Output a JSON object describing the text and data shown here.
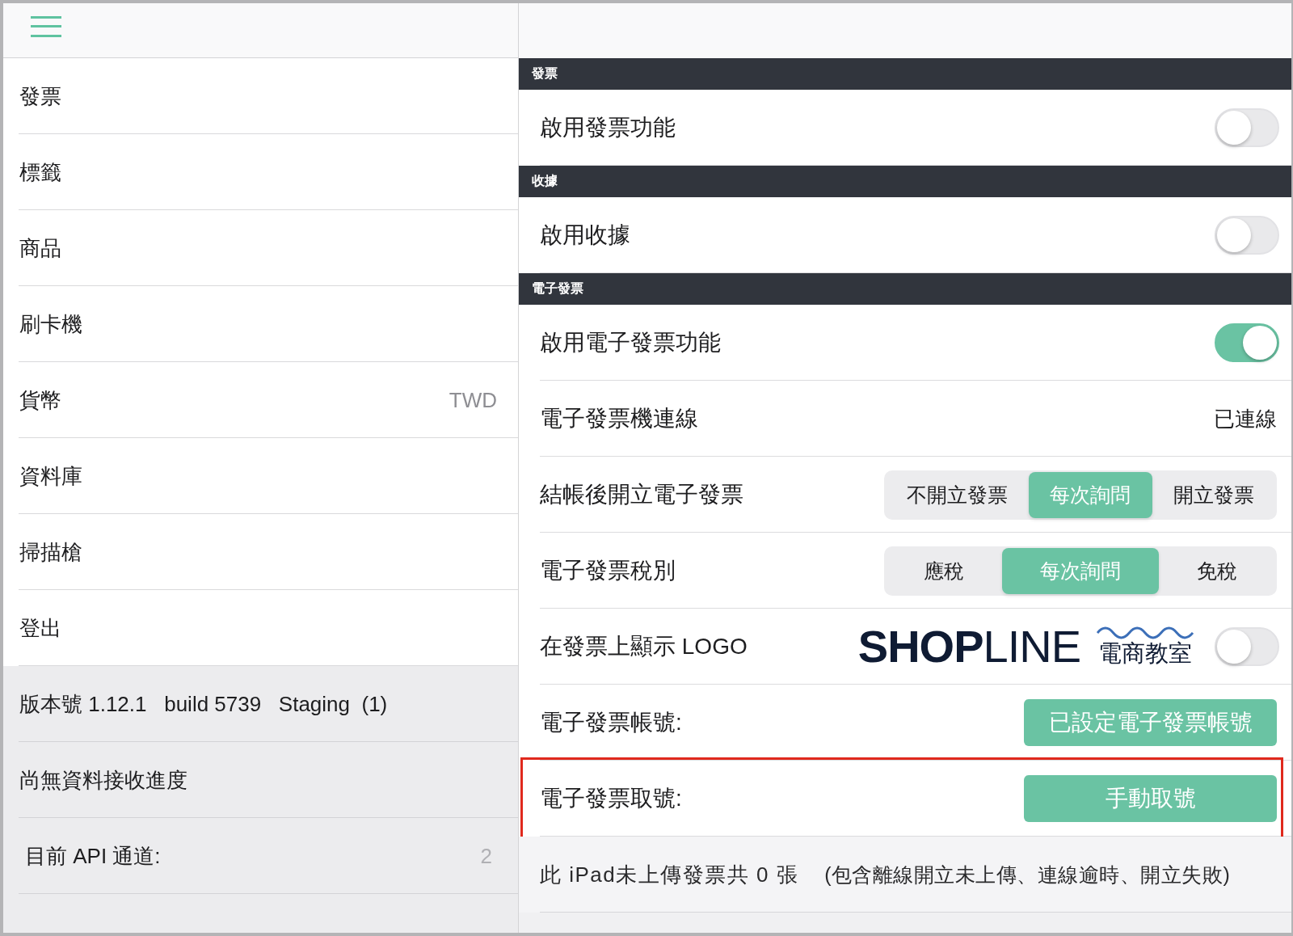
{
  "sidebar": {
    "items": [
      {
        "label": "發票",
        "selected": false
      },
      {
        "label": "標籤",
        "selected": false
      },
      {
        "label": "商品",
        "selected": false
      },
      {
        "label": "刷卡機",
        "selected": false
      },
      {
        "label": "貨幣",
        "value": "TWD",
        "selected": false
      },
      {
        "label": "資料庫",
        "selected": false
      },
      {
        "label": "掃描槍",
        "selected": false
      },
      {
        "label": "登出",
        "selected": false
      }
    ],
    "status": [
      {
        "text": "版本號 1.12.1   build 5739   Staging  (1)"
      },
      {
        "text": "尚無資料接收進度"
      },
      {
        "text": "目前 API 通道:",
        "value": "2"
      }
    ]
  },
  "settings": {
    "sections": [
      {
        "title": "發票",
        "rows": [
          {
            "kind": "toggle",
            "label": "啟用發票功能",
            "on": false
          }
        ]
      },
      {
        "title": "收據",
        "rows": [
          {
            "kind": "toggle",
            "label": "啟用收據",
            "on": false
          }
        ]
      },
      {
        "title": "電子發票",
        "rows": [
          {
            "kind": "toggle",
            "label": "啟用電子發票功能",
            "on": true
          },
          {
            "kind": "value",
            "label": "電子發票機連線",
            "value": "已連線"
          },
          {
            "kind": "segmented",
            "label": "結帳後開立電子發票",
            "options": [
              {
                "label": "不開立發票",
                "selected": false
              },
              {
                "label": "每次詢問",
                "selected": true
              },
              {
                "label": "開立發票",
                "selected": false
              }
            ]
          },
          {
            "kind": "segmented",
            "label": "電子發票稅別",
            "options": [
              {
                "label": "應稅",
                "selected": false
              },
              {
                "label": "每次詢問",
                "selected": true
              },
              {
                "label": "免稅",
                "selected": false
              }
            ]
          },
          {
            "kind": "logo_toggle",
            "label": "在發票上顯示 LOGO",
            "logo": {
              "wordmark": "**SHOP**LINE",
              "tagline": "電商教室"
            },
            "on": false
          },
          {
            "kind": "button",
            "label": "電子發票帳號:",
            "button": "已設定電子發票帳號",
            "highlighted": false
          },
          {
            "kind": "button",
            "label": "電子發票取號:",
            "button": "手動取號",
            "highlighted": true
          },
          {
            "kind": "note",
            "text": "此 iPad未上傳發票共 0 張",
            "note": "(包含離線開立未上傳、連線逾時、開立失敗)"
          }
        ]
      }
    ]
  }
}
